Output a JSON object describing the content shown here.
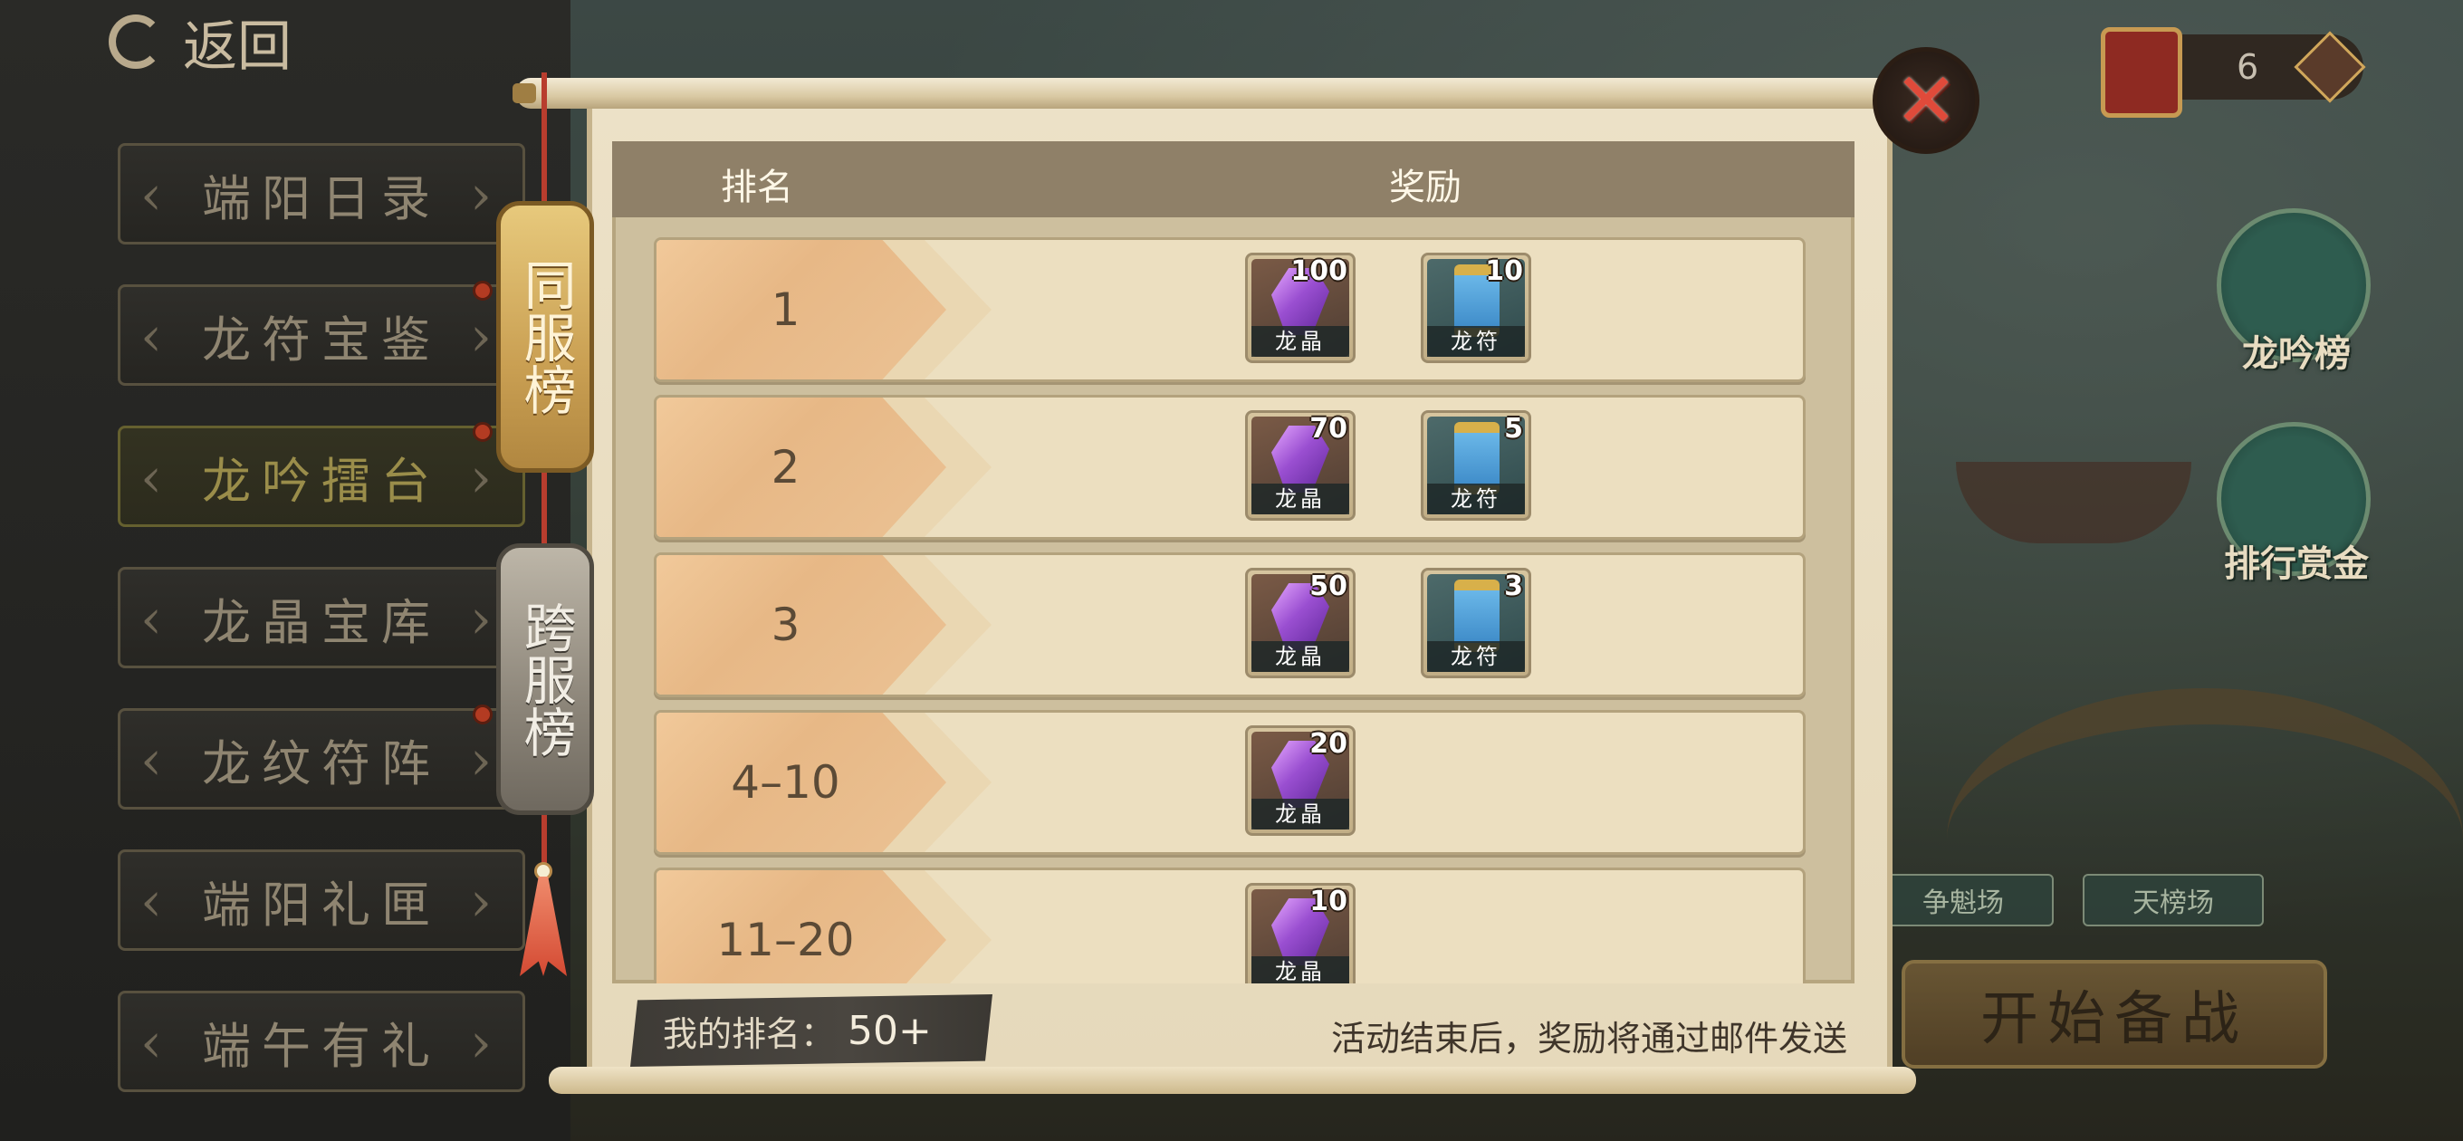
{
  "top": {
    "back_label": "返回",
    "currency_value": "6"
  },
  "menu": [
    {
      "label": "端阳日录"
    },
    {
      "label": "龙符宝鉴"
    },
    {
      "label": "龙吟擂台"
    },
    {
      "label": "龙晶宝库"
    },
    {
      "label": "龙纹符阵"
    },
    {
      "label": "端阳礼匣"
    },
    {
      "label": "端午有礼"
    }
  ],
  "side": {
    "ranking_label": "龙吟榜",
    "bounty_label": "排行赏金",
    "arena_label": "争魁场",
    "sky_label": "天榜场",
    "start_label": "开始备战"
  },
  "tabs": {
    "same_server": "同服榜",
    "cross_server": "跨服榜"
  },
  "table": {
    "col_rank": "排名",
    "col_reward": "奖励",
    "rows": [
      {
        "rank": "1",
        "rewards": [
          {
            "name": "龙晶",
            "count": "100"
          },
          {
            "name": "龙符",
            "count": "10"
          }
        ]
      },
      {
        "rank": "2",
        "rewards": [
          {
            "name": "龙晶",
            "count": "70"
          },
          {
            "name": "龙符",
            "count": "5"
          }
        ]
      },
      {
        "rank": "3",
        "rewards": [
          {
            "name": "龙晶",
            "count": "50"
          },
          {
            "name": "龙符",
            "count": "3"
          }
        ]
      },
      {
        "rank": "4–10",
        "rewards": [
          {
            "name": "龙晶",
            "count": "20"
          }
        ]
      },
      {
        "rank": "11–20",
        "rewards": [
          {
            "name": "龙晶",
            "count": "10"
          }
        ]
      }
    ]
  },
  "footer": {
    "my_rank_label": "我的排名：",
    "my_rank_value": "50+",
    "note": "活动结束后，奖励将通过邮件发送"
  },
  "colors": {
    "accent_gold": "#caa053",
    "close_red": "#e04a3a"
  }
}
